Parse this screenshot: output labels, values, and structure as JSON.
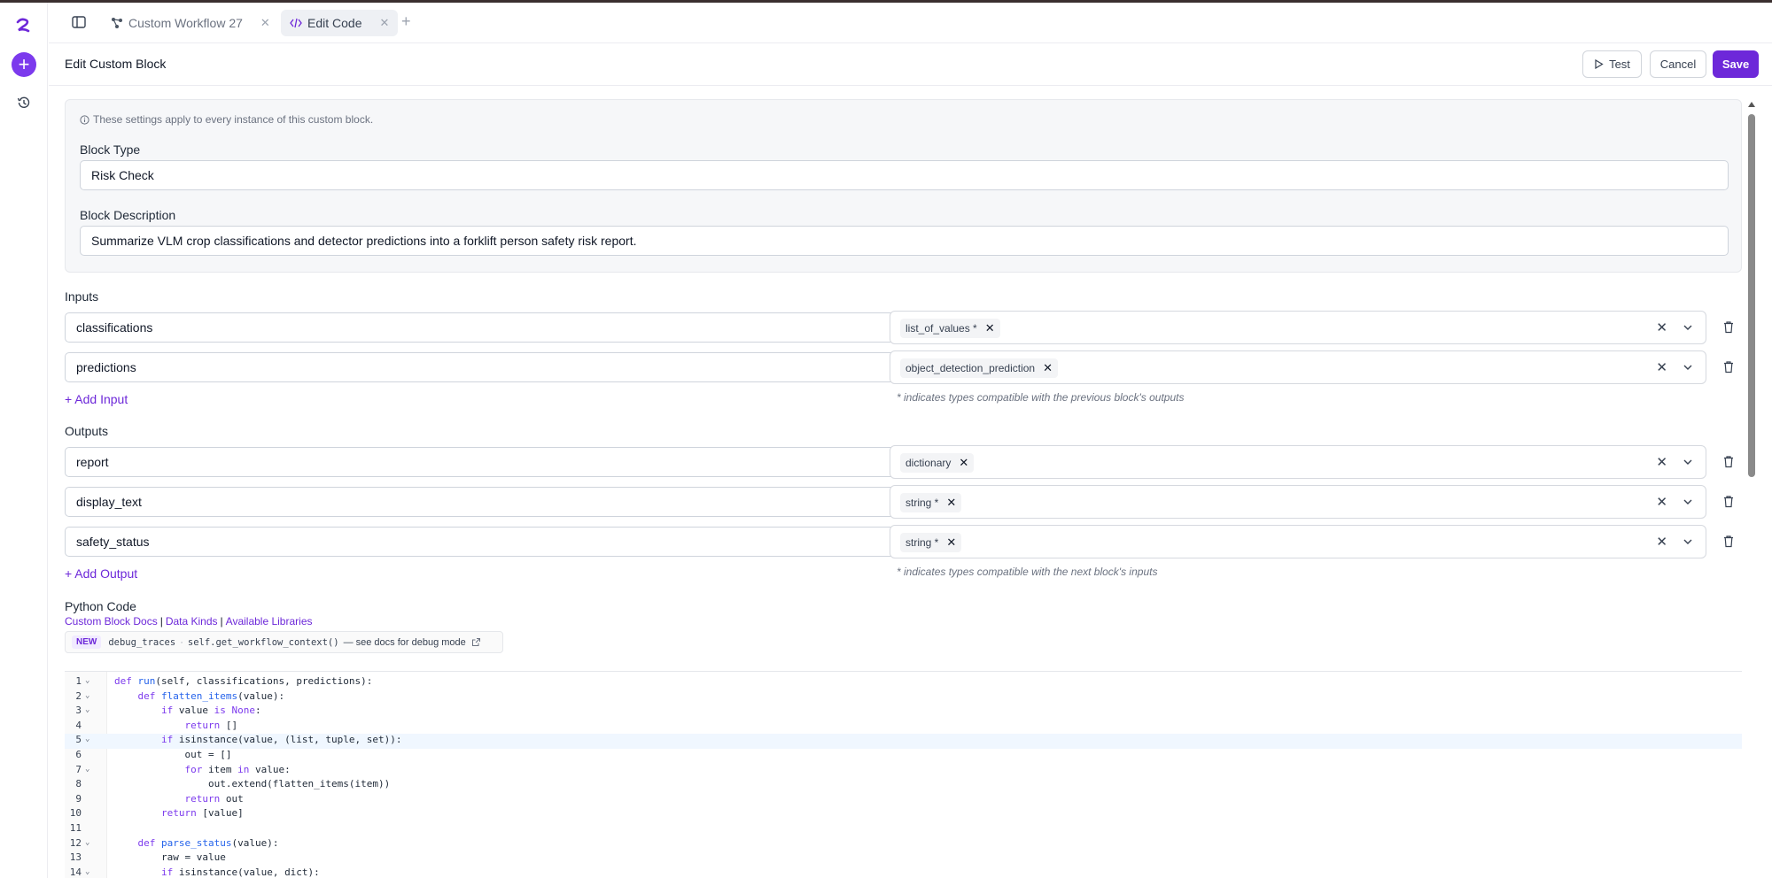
{
  "tabs": [
    {
      "label": "Custom Workflow 27",
      "icon": "workflow-icon"
    },
    {
      "label": "Edit Code",
      "icon": "code-icon"
    }
  ],
  "header": {
    "title": "Edit Custom Block",
    "test_label": "Test",
    "cancel_label": "Cancel",
    "save_label": "Save"
  },
  "settings": {
    "note": "These settings apply to every instance of this custom block.",
    "block_type_label": "Block Type",
    "block_type_value": "Risk Check",
    "block_description_label": "Block Description",
    "block_description_value": "Summarize VLM crop classifications and detector predictions into a forklift person safety risk report."
  },
  "inputs": {
    "label": "Inputs",
    "rows": [
      {
        "name": "classifications",
        "kind": "list_of_values *"
      },
      {
        "name": "predictions",
        "kind": "object_detection_prediction"
      }
    ],
    "add_label": "+ Add Input",
    "hint": "* indicates types compatible with the previous block's outputs"
  },
  "outputs": {
    "label": "Outputs",
    "rows": [
      {
        "name": "report",
        "kind": "dictionary"
      },
      {
        "name": "display_text",
        "kind": "string *"
      },
      {
        "name": "safety_status",
        "kind": "string *"
      }
    ],
    "add_label": "+ Add Output",
    "hint": "* indicates types compatible with the next block's inputs"
  },
  "python": {
    "title": "Python Code",
    "links": [
      "Custom Block Docs",
      "Data Kinds",
      "Available Libraries"
    ],
    "new_badge": "NEW",
    "new_code_1": "debug_traces",
    "new_code_2": "self.get_workflow_context()",
    "new_text": "— see docs for debug mode",
    "code_lines": [
      {
        "n": "1",
        "fold": true,
        "text": "def run(self, classifications, predictions):"
      },
      {
        "n": "2",
        "fold": true,
        "text": "    def flatten_items(value):"
      },
      {
        "n": "3",
        "fold": true,
        "text": "        if value is None:"
      },
      {
        "n": "4",
        "fold": false,
        "text": "            return []"
      },
      {
        "n": "5",
        "fold": true,
        "text": "        if isinstance(value, (list, tuple, set)):"
      },
      {
        "n": "6",
        "fold": false,
        "text": "            out = []"
      },
      {
        "n": "7",
        "fold": true,
        "text": "            for item in value:"
      },
      {
        "n": "8",
        "fold": false,
        "text": "                out.extend(flatten_items(item))"
      },
      {
        "n": "9",
        "fold": false,
        "text": "            return out"
      },
      {
        "n": "10",
        "fold": false,
        "text": "        return [value]"
      },
      {
        "n": "11",
        "fold": false,
        "text": ""
      },
      {
        "n": "12",
        "fold": true,
        "text": "    def parse_status(value):"
      },
      {
        "n": "13",
        "fold": false,
        "text": "        raw = value"
      },
      {
        "n": "14",
        "fold": true,
        "text": "        if isinstance(value, dict):"
      }
    ]
  }
}
